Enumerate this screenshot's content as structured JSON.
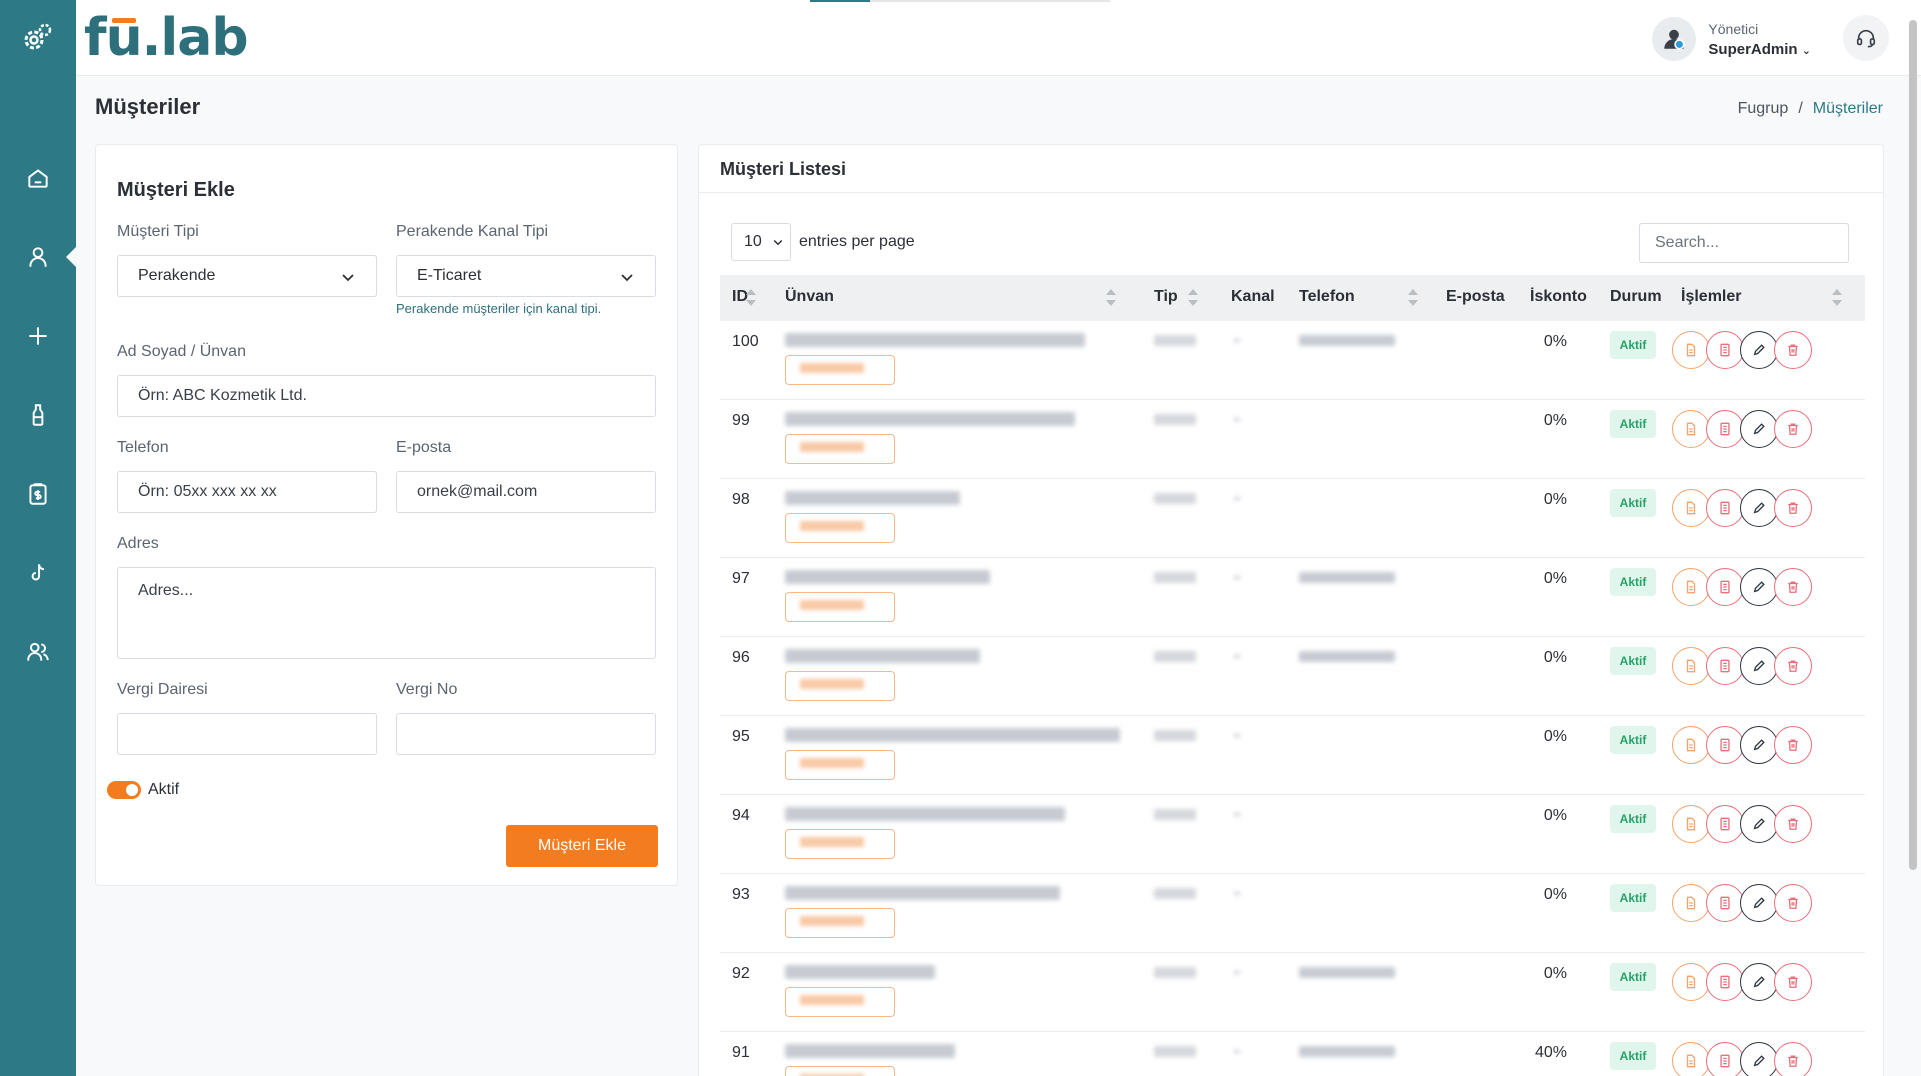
{
  "brand": {
    "name_prefix": "f",
    "name_u": "u",
    "name_suffix": ".lab"
  },
  "header": {
    "role": "Yönetici",
    "username": "SuperAdmin"
  },
  "page": {
    "title": "Müşteriler",
    "breadcrumb": [
      "Fugrup",
      "/",
      "Müşteriler"
    ]
  },
  "sidebar": {
    "items": [
      "home-icon",
      "user-icon",
      "plus-icon",
      "bottle-icon",
      "invoice-icon",
      "tiktok-icon",
      "users-icon"
    ],
    "active_index": 1
  },
  "form": {
    "title": "Müşteri Ekle",
    "customer_type_label": "Müşteri Tipi",
    "customer_type_value": "Perakende",
    "channel_label": "Perakende Kanal Tipi",
    "channel_value": "E-Ticaret",
    "channel_hint": "Perakende müşteriler için kanal tipi.",
    "name_label": "Ad Soyad / Ünvan",
    "name_placeholder": "Örn: ABC Kozmetik Ltd.",
    "phone_label": "Telefon",
    "phone_placeholder": "Örn: 05xx xxx xx xx",
    "email_label": "E-posta",
    "email_placeholder": "ornek@mail.com",
    "address_label": "Adres",
    "address_placeholder": "Adres...",
    "tax_office_label": "Vergi Dairesi",
    "tax_no_label": "Vergi No",
    "active_label": "Aktif",
    "active": true,
    "submit": "Müşteri Ekle"
  },
  "list": {
    "title": "Müşteri Listesi",
    "entries_value": "10",
    "entries_text": "entries per page",
    "search_placeholder": "Search...",
    "columns": [
      "ID",
      "Ünvan",
      "Tip",
      "Kanal",
      "Telefon",
      "E-posta",
      "İskonto",
      "Durum",
      "İşlemler"
    ],
    "rows": [
      {
        "id": "100",
        "discount": "0%",
        "status": "Aktif",
        "has_phone": true
      },
      {
        "id": "99",
        "discount": "0%",
        "status": "Aktif",
        "has_phone": false
      },
      {
        "id": "98",
        "discount": "0%",
        "status": "Aktif",
        "has_phone": false
      },
      {
        "id": "97",
        "discount": "0%",
        "status": "Aktif",
        "has_phone": true
      },
      {
        "id": "96",
        "discount": "0%",
        "status": "Aktif",
        "has_phone": true
      },
      {
        "id": "95",
        "discount": "0%",
        "status": "Aktif",
        "has_phone": false
      },
      {
        "id": "94",
        "discount": "0%",
        "status": "Aktif",
        "has_phone": false
      },
      {
        "id": "93",
        "discount": "0%",
        "status": "Aktif",
        "has_phone": false
      },
      {
        "id": "92",
        "discount": "0%",
        "status": "Aktif",
        "has_phone": true
      },
      {
        "id": "91",
        "discount": "40%",
        "status": "Aktif",
        "has_phone": true
      }
    ]
  },
  "colors": {
    "sidebar": "#2d7a86",
    "accent": "#f47c20",
    "brand": "#2d6f7a",
    "success": "#26a269",
    "danger": "#e96d7a"
  }
}
